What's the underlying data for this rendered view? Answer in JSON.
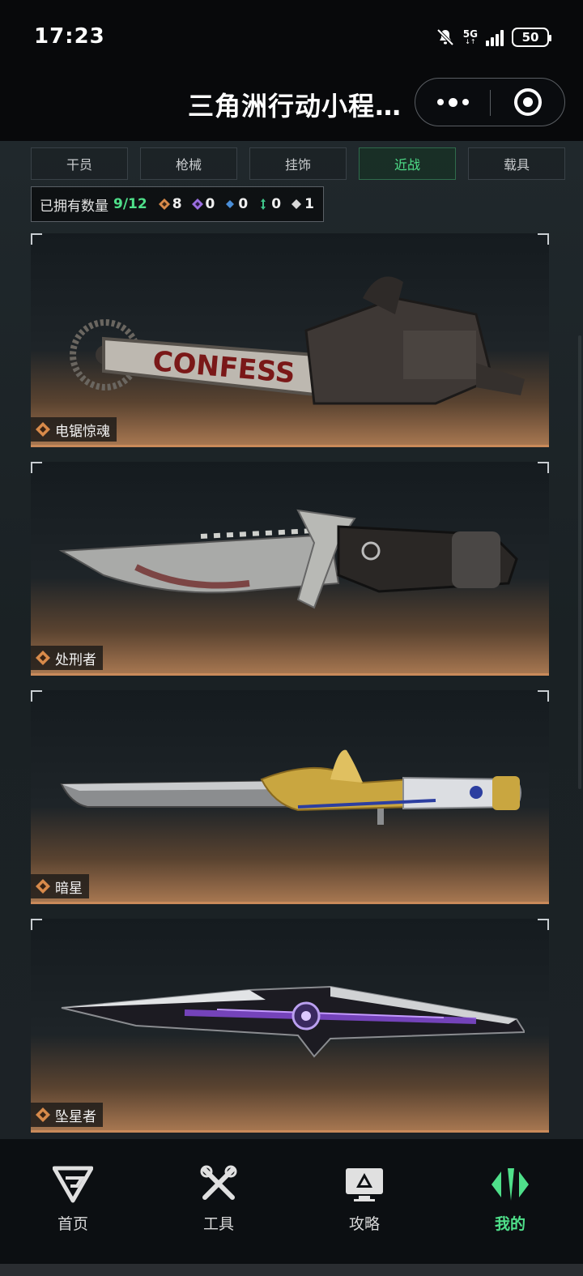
{
  "status_bar": {
    "time": "17:23",
    "network": "5G",
    "battery": "50"
  },
  "header": {
    "title": "三角洲行动小程…"
  },
  "tabs": [
    {
      "label": "干员",
      "active": false
    },
    {
      "label": "枪械",
      "active": false
    },
    {
      "label": "挂饰",
      "active": false
    },
    {
      "label": "近战",
      "active": true
    },
    {
      "label": "载具",
      "active": false
    }
  ],
  "ownership": {
    "label": "已拥有数量",
    "count": "9/12",
    "rarities": [
      {
        "icon": "orange-gem-icon",
        "color": "#d88a4a",
        "count": "8"
      },
      {
        "icon": "purple-gem-icon",
        "color": "#9a6ee0",
        "count": "0"
      },
      {
        "icon": "blue-gem-icon",
        "color": "#4a8ed8",
        "count": "0"
      },
      {
        "icon": "green-gem-icon",
        "color": "#3fc58a",
        "count": "0"
      },
      {
        "icon": "white-gem-icon",
        "color": "#d8d8d8",
        "count": "1"
      }
    ]
  },
  "items": [
    {
      "name": "电锯惊魂",
      "weapon_text": "CONFESS"
    },
    {
      "name": "处刑者"
    },
    {
      "name": "暗星"
    },
    {
      "name": "坠星者"
    }
  ],
  "nav": [
    {
      "label": "首页",
      "icon": "home-g-icon",
      "active": false
    },
    {
      "label": "工具",
      "icon": "tools-icon",
      "active": false
    },
    {
      "label": "攻略",
      "icon": "guide-monitor-icon",
      "active": false
    },
    {
      "label": "我的",
      "icon": "profile-icon",
      "active": true
    }
  ],
  "colors": {
    "accent": "#4fe08a",
    "card_rarity": "#c98a5a"
  }
}
